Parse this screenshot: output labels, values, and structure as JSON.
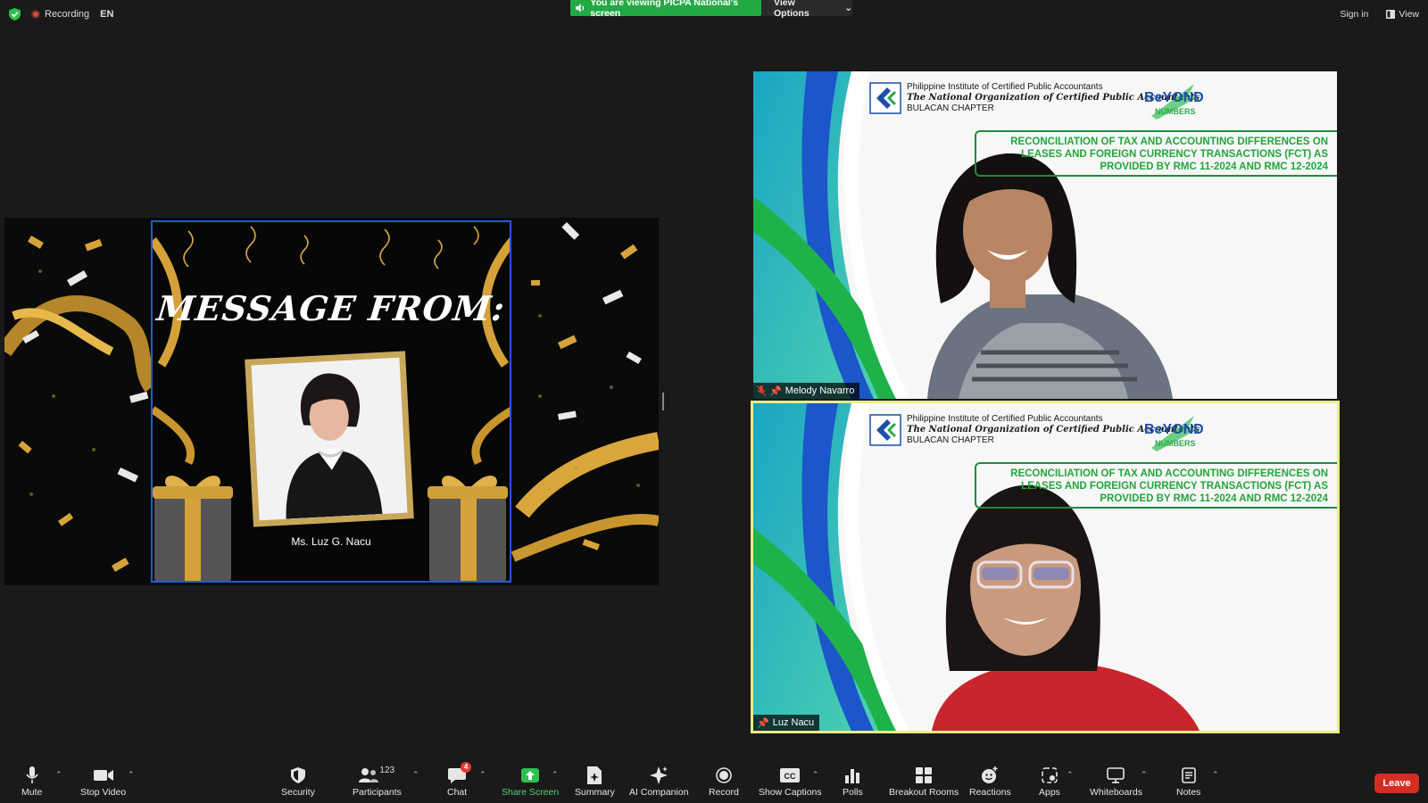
{
  "topbar": {
    "recording": "Recording",
    "language": "EN",
    "viewing_banner": "You are viewing PICPA National's screen",
    "view_options": "View Options",
    "sign_in": "Sign in",
    "view": "View"
  },
  "share": {
    "slide_title": "MESSAGE FROM:",
    "caption": "Ms. Luz G. Nacu"
  },
  "tiles": [
    {
      "org_line1": "Philippine Institute of Certified Public Accountants",
      "org_line2": "The National Organization of Certified Public Accountants",
      "org_line3": "BULACAN CHAPTER",
      "badge": "BEYOND NUMBERS",
      "topic": "RECONCILIATION OF TAX AND ACCOUNTING DIFFERENCES ON LEASES AND FOREIGN CURRENCY TRANSACTIONS (FCT) AS PROVIDED BY RMC 11-2024 AND RMC 12-2024",
      "name": "Melody Navarro"
    },
    {
      "org_line1": "Philippine Institute of Certified Public Accountants",
      "org_line2": "The National Organization of Certified Public Accountants",
      "org_line3": "BULACAN CHAPTER",
      "badge": "BEYOND NUMBERS",
      "topic": "RECONCILIATION OF TAX AND ACCOUNTING DIFFERENCES ON LEASES AND FOREIGN CURRENCY TRANSACTIONS (FCT) AS PROVIDED BY RMC 11-2024 AND RMC 12-2024",
      "name": "Luz Nacu"
    }
  ],
  "toolbar": {
    "mute": "Mute",
    "stop_video": "Stop Video",
    "security": "Security",
    "participants": "Participants",
    "participants_count": "123",
    "chat": "Chat",
    "chat_badge": "4",
    "share_screen": "Share Screen",
    "summary": "Summary",
    "ai_companion": "AI Companion",
    "record": "Record",
    "show_captions": "Show Captions",
    "polls": "Polls",
    "breakout_rooms": "Breakout Rooms",
    "reactions": "Reactions",
    "apps": "Apps",
    "whiteboards": "Whiteboards",
    "notes": "Notes",
    "leave": "Leave"
  },
  "colors": {
    "share_green": "#23a846",
    "leave_red": "#d42d24",
    "active_speaker": "#e8ec8a",
    "topic_green": "#23a53c",
    "slide_border": "#2758d6"
  }
}
